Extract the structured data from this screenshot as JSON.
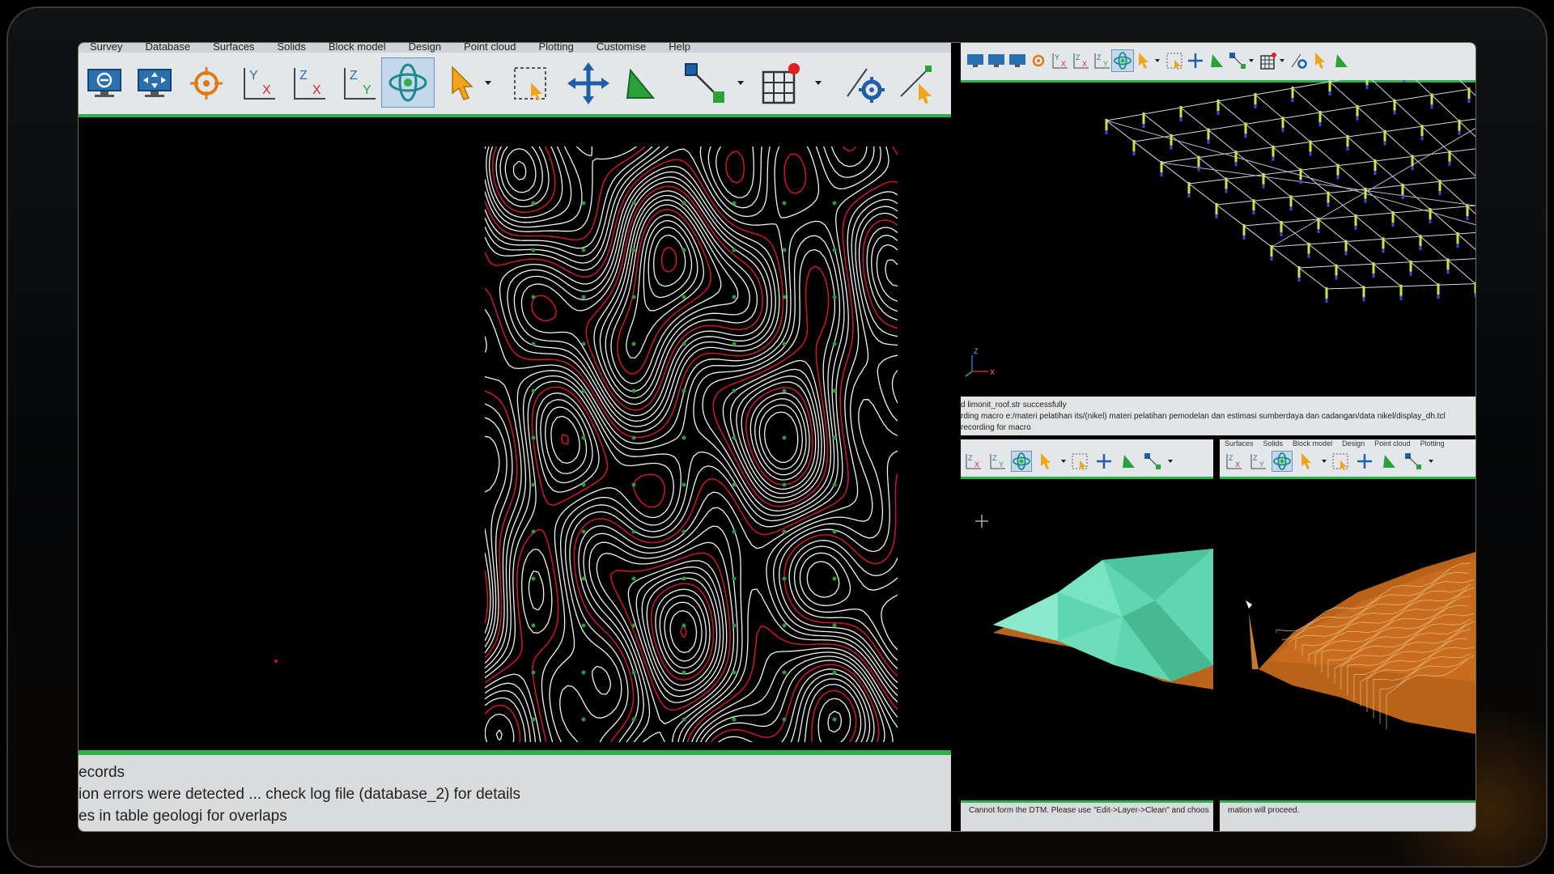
{
  "left_pane": {
    "menu_items": [
      "Survey",
      "Database",
      "Surfaces",
      "Solids",
      "Block model",
      "Design",
      "Point cloud",
      "Plotting",
      "Customise",
      "Help"
    ],
    "status_lines": [
      "ecords",
      "ion errors were detected ... check log file (database_2) for details",
      "es in table geologi for overlaps"
    ]
  },
  "top_right_pane": {
    "log_lines": [
      "d limonit_roof.str successfully",
      "rding macro e:/materi pelatihan its/(nikel) materi pelatihan pemodelan dan estimasi sumberdaya dan cadangan/data nikel/display_dh.tcl",
      "recording for macro"
    ],
    "axis_labels": {
      "z": "Z",
      "x": "X"
    }
  },
  "bottom_left_pane": {
    "status_text": "Cannot form the DTM. Please use \"Edit->Layer->Clean\" and choos"
  },
  "bottom_right_pane": {
    "menu_items": [
      "Surfaces",
      "Solids",
      "Block model",
      "Design",
      "Point cloud",
      "Plotting"
    ],
    "status_text": "mation will proceed."
  },
  "icons": {
    "zoom_out": "zoom-out-monitor-icon",
    "zoom_extents": "zoom-extents-icon",
    "target": "crosshair-target-icon",
    "view_yx": "view-yx-icon",
    "view_zx": "view-zx-icon",
    "view_zy": "view-zy-icon",
    "rotate": "rotate-3d-icon",
    "select": "select-arrow-icon",
    "box_select": "box-select-icon",
    "pan": "pan-icon",
    "triangle": "triangle-icon",
    "line_tool": "line-tool-icon",
    "grid": "grid-icon",
    "settings": "settings-icon"
  },
  "colors": {
    "toolbar_bg": "#e4e7ea",
    "green_accent": "#2bb34a",
    "contour_white": "#f2f2f2",
    "contour_red": "#c0182a",
    "dtm_teal": "#5fd6b0",
    "dtm_orange": "#c86d1e"
  }
}
